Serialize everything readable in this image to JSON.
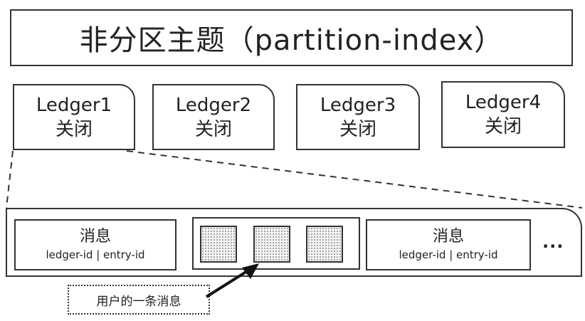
{
  "topic": {
    "label": "非分区主题（partition-index）"
  },
  "ledgers": [
    {
      "name": "Ledger1",
      "state": "关闭"
    },
    {
      "name": "Ledger2",
      "state": "关闭"
    },
    {
      "name": "Ledger3",
      "state": "关闭"
    },
    {
      "name": "Ledger4",
      "state": "关闭"
    }
  ],
  "messages": [
    {
      "title": "消息",
      "subtitle": "ledger-id | entry-id"
    },
    {
      "title": "消息",
      "subtitle": "ledger-id | entry-id"
    }
  ],
  "ellipsis": "...",
  "callout": {
    "label": "用户的一条消息"
  }
}
